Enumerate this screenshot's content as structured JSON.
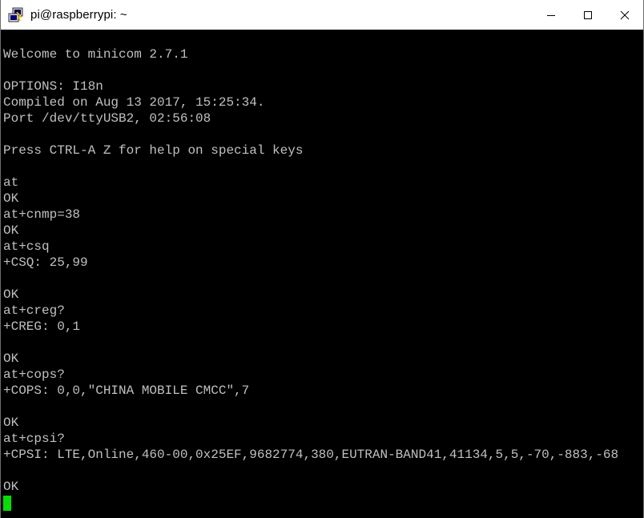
{
  "window": {
    "title": "pi@raspberrypi: ~",
    "app_icon": "putty-icon",
    "controls": {
      "minimize_icon": "minimize-icon",
      "maximize_icon": "maximize-icon",
      "close_icon": "close-icon"
    }
  },
  "colors": {
    "terminal_background": "#000000",
    "terminal_text": "#c0c0c0",
    "cursor": "#00e000",
    "titlebar_background": "#ffffff"
  },
  "terminal": {
    "lines": [
      "Welcome to minicom 2.7.1",
      "",
      "OPTIONS: I18n",
      "Compiled on Aug 13 2017, 15:25:34.",
      "Port /dev/ttyUSB2, 02:56:08",
      "",
      "Press CTRL-A Z for help on special keys",
      "",
      "at",
      "OK",
      "at+cnmp=38",
      "OK",
      "at+csq",
      "+CSQ: 25,99",
      "",
      "OK",
      "at+creg?",
      "+CREG: 0,1",
      "",
      "OK",
      "at+cops?",
      "+COPS: 0,0,\"CHINA MOBILE CMCC\",7",
      "",
      "OK",
      "at+cpsi?",
      "+CPSI: LTE,Online,460-00,0x25EF,9682774,380,EUTRAN-BAND41,41134,5,5,-70,-883,-68",
      "",
      "OK"
    ]
  }
}
